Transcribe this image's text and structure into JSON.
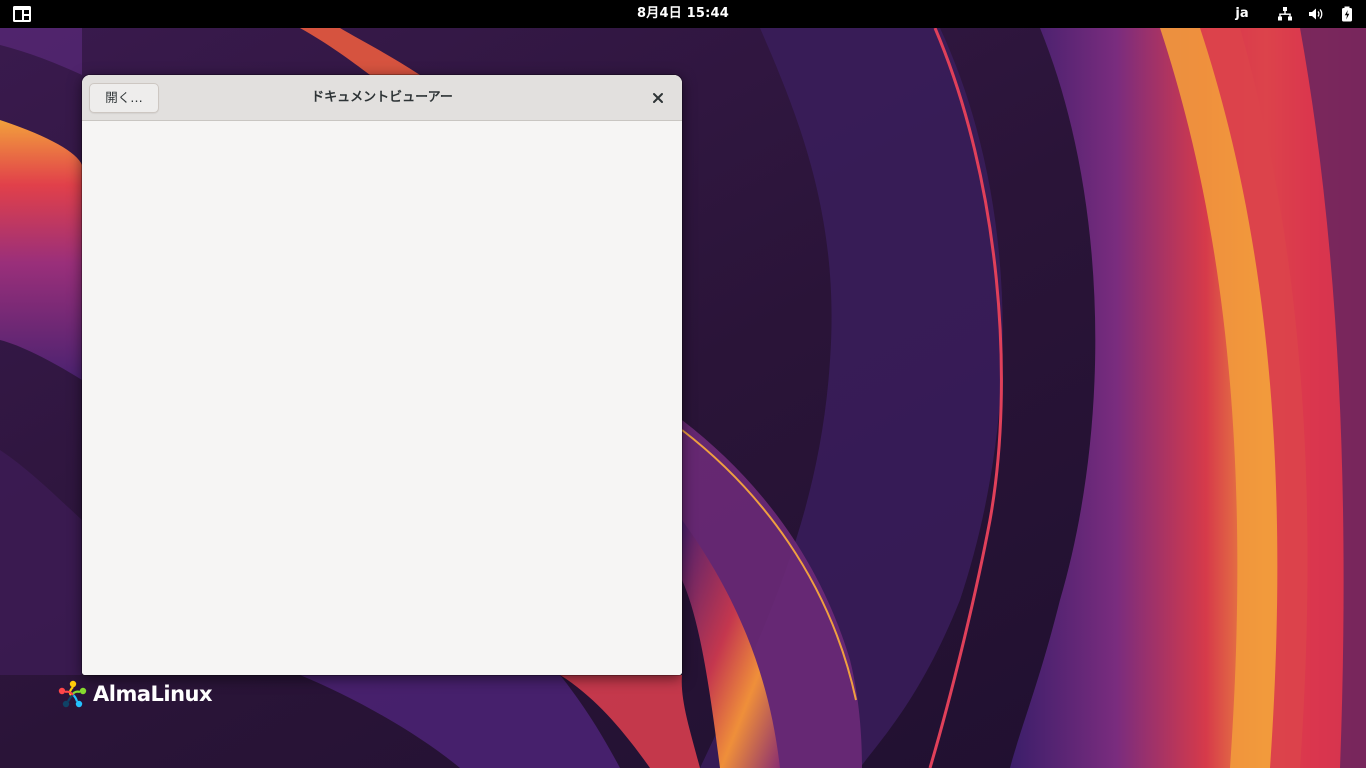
{
  "topbar": {
    "activities_icon": "activities-grid-icon",
    "clock": "8月4日  15:44",
    "input_language": "ja",
    "tray_icons": [
      "network-wired-icon",
      "volume-icon",
      "battery-charging-icon"
    ]
  },
  "window": {
    "title": "ドキュメントビューアー",
    "open_button_label": "開く…",
    "close_icon": "close-icon"
  },
  "desktop": {
    "logo_text": "AlmaLinux",
    "logo_icon": "almalinux-logo-icon"
  },
  "colors": {
    "topbar_bg": "#000000",
    "window_bg": "#f6f5f4",
    "headerbar_bg": "#e2e0de",
    "wallpaper_base": "#2a1438",
    "wallpaper_accents": [
      "#e23b4e",
      "#f29a3c",
      "#7a2c8c",
      "#3b1f6b"
    ]
  }
}
